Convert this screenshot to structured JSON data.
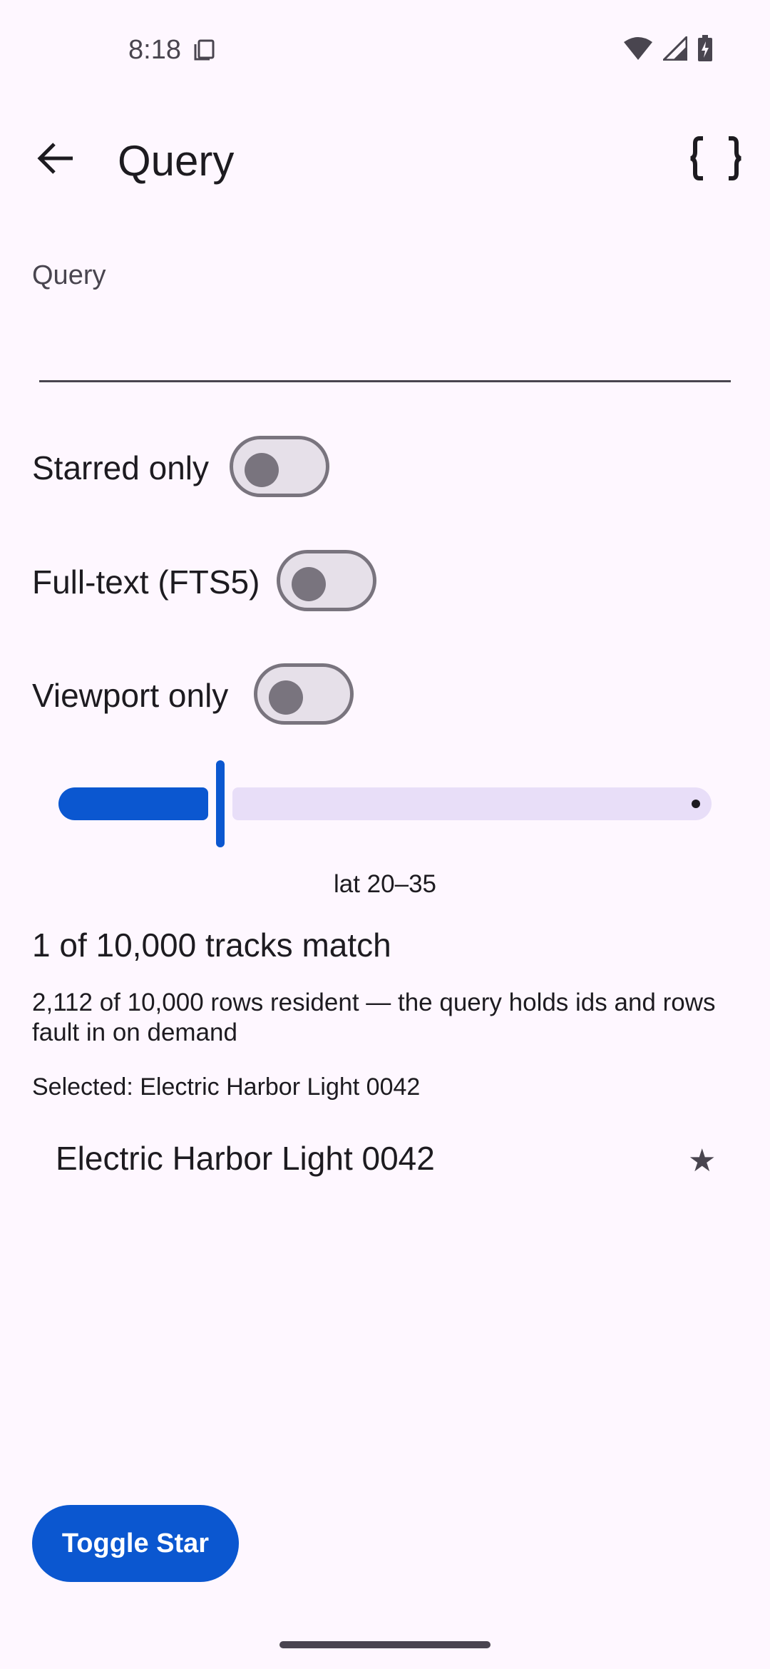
{
  "status_bar": {
    "time": "8:18",
    "icons": [
      "document-icon",
      "wifi-icon",
      "cell-signal-icon",
      "battery-charging-icon"
    ]
  },
  "app_bar": {
    "title": "Query",
    "back_icon": "arrow-back-icon",
    "action_icon": "data-object-braces-icon"
  },
  "query_field": {
    "label": "Query",
    "value": "",
    "placeholder": ""
  },
  "toggles": [
    {
      "label": "Starred only",
      "checked": false
    },
    {
      "label": "Full-text (FTS5)",
      "checked": false
    },
    {
      "label": "Viewport only",
      "checked": false
    }
  ],
  "slider": {
    "caption": "lat 20–35",
    "value_fraction": 0.25
  },
  "results": {
    "match_summary": "1 of 10,000 tracks match",
    "resident_info": "2,112 of 10,000 rows resident — the query holds ids and rows fault in on demand",
    "selected": "Selected: Electric Harbor Light 0042"
  },
  "list": [
    {
      "title": "Electric Harbor Light 0042",
      "starred": true,
      "star_glyph": "★"
    }
  ],
  "fab": {
    "label": "Toggle Star"
  },
  "colors": {
    "background": "#FEF7FF",
    "primary": "#0B57D0",
    "slider_inactive": "#E8DEF8",
    "switch_track": "#E6E0E9",
    "switch_outline": "#79747E",
    "on_surface": "#1D1B20",
    "on_surface_variant": "#49454F"
  }
}
